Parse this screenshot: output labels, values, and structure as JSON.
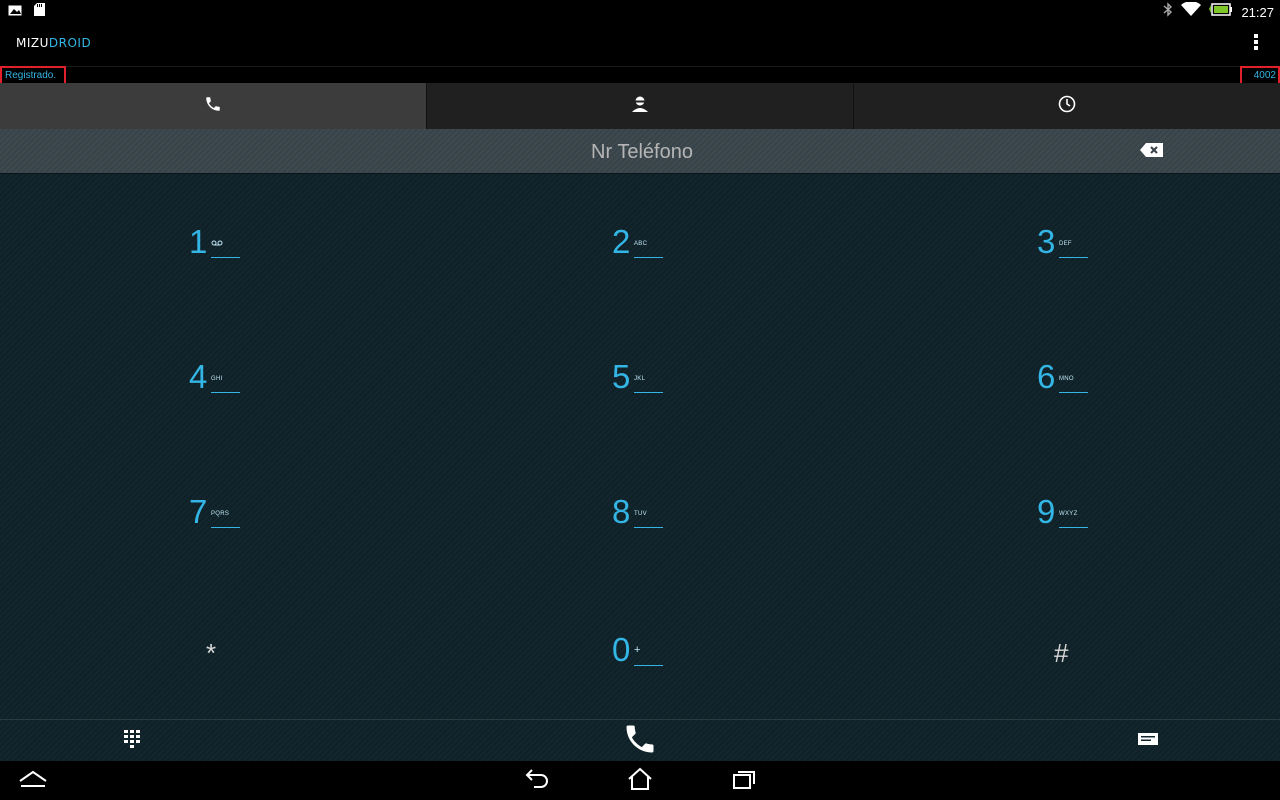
{
  "status_bar": {
    "time": "21:27",
    "icons": [
      "picture-icon",
      "sd-card-icon",
      "bluetooth-icon",
      "wifi-icon",
      "battery-icon"
    ]
  },
  "app": {
    "logo_part1": "MIZU",
    "logo_part2": "DROID",
    "menu_icon": "overflow-menu-icon"
  },
  "registration": {
    "status": "Registrado.",
    "user": "4002"
  },
  "tabs": [
    {
      "name": "dialer",
      "icon": "phone-icon",
      "active": true
    },
    {
      "name": "contacts",
      "icon": "contact-icon",
      "active": false
    },
    {
      "name": "history",
      "icon": "clock-icon",
      "active": false
    }
  ],
  "number_field": {
    "placeholder": "Nr Teléfono",
    "value": ""
  },
  "keypad": [
    {
      "digit": "1",
      "letters": "voicemail"
    },
    {
      "digit": "2",
      "letters": "ABC"
    },
    {
      "digit": "3",
      "letters": "DEF"
    },
    {
      "digit": "4",
      "letters": "GHI"
    },
    {
      "digit": "5",
      "letters": "JKL"
    },
    {
      "digit": "6",
      "letters": "MNO"
    },
    {
      "digit": "7",
      "letters": "PQRS"
    },
    {
      "digit": "8",
      "letters": "TUV"
    },
    {
      "digit": "9",
      "letters": "WXYZ"
    },
    {
      "digit": "*",
      "letters": ""
    },
    {
      "digit": "0",
      "letters": "+"
    },
    {
      "digit": "#",
      "letters": ""
    }
  ],
  "bottom_bar": {
    "left_icon": "keypad-icon",
    "center_icon": "call-icon",
    "right_icon": "message-icon"
  },
  "nav_bar": {
    "icons": [
      "up-arrow-icon",
      "back-icon",
      "home-icon",
      "recents-icon"
    ]
  },
  "colors": {
    "accent": "#33b5e5",
    "highlight_box": "#e0202a"
  }
}
